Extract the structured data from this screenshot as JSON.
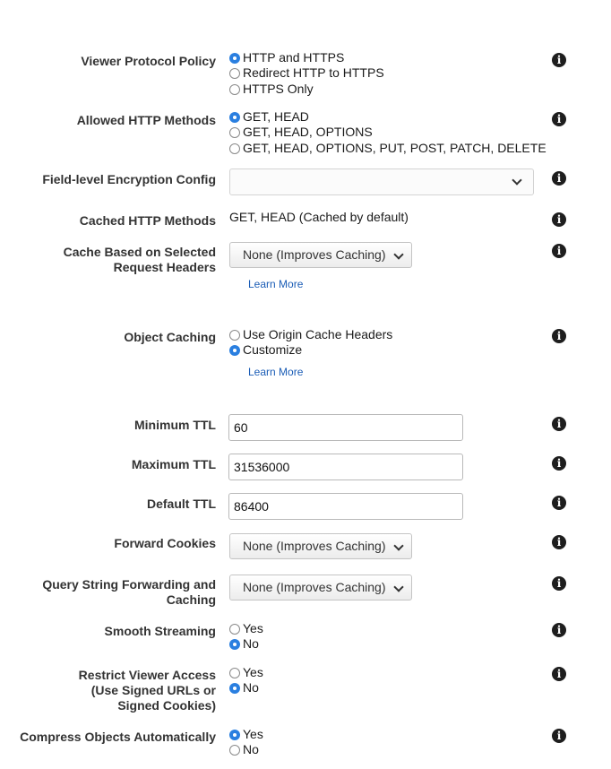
{
  "viewer_protocol": {
    "label": "Viewer Protocol Policy",
    "options": [
      "HTTP and HTTPS",
      "Redirect HTTP to HTTPS",
      "HTTPS Only"
    ],
    "selected": "HTTP and HTTPS"
  },
  "allowed_methods": {
    "label": "Allowed HTTP Methods",
    "options": [
      "GET, HEAD",
      "GET, HEAD, OPTIONS",
      "GET, HEAD, OPTIONS, PUT, POST, PATCH, DELETE"
    ],
    "selected": "GET, HEAD"
  },
  "fle_config": {
    "label": "Field-level Encryption Config",
    "value": ""
  },
  "cached_methods": {
    "label": "Cached HTTP Methods",
    "value": "GET, HEAD (Cached by default)"
  },
  "cache_headers": {
    "label_line1": "Cache Based on Selected",
    "label_line2": "Request Headers",
    "value": "None (Improves Caching)",
    "learn_more": "Learn More"
  },
  "object_caching": {
    "label": "Object Caching",
    "options": [
      "Use Origin Cache Headers",
      "Customize"
    ],
    "selected": "Customize",
    "learn_more": "Learn More"
  },
  "min_ttl": {
    "label": "Minimum TTL",
    "value": "60"
  },
  "max_ttl": {
    "label": "Maximum TTL",
    "value": "31536000"
  },
  "default_ttl": {
    "label": "Default TTL",
    "value": "86400"
  },
  "forward_cookies": {
    "label": "Forward Cookies",
    "value": "None (Improves Caching)"
  },
  "query_string": {
    "label_line1": "Query String Forwarding and",
    "label_line2": "Caching",
    "value": "None (Improves Caching)"
  },
  "smooth_streaming": {
    "label": "Smooth Streaming",
    "options": [
      "Yes",
      "No"
    ],
    "selected": "No"
  },
  "restrict_access": {
    "label_line1": "Restrict Viewer Access",
    "label_line2": "(Use Signed URLs or",
    "label_line3": "Signed Cookies)",
    "options": [
      "Yes",
      "No"
    ],
    "selected": "No"
  },
  "compress": {
    "label": "Compress Objects Automatically",
    "options": [
      "Yes",
      "No"
    ],
    "selected": "Yes"
  },
  "info_glyph": "i",
  "accent_color": "#2a7fe0",
  "link_color": "#1b5db6"
}
